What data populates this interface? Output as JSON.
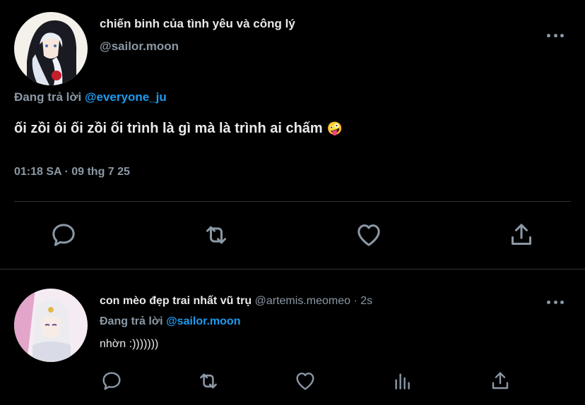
{
  "tweet": {
    "author_name": "chiến binh của tình yêu và công lý",
    "author_handle": "@sailor.moon",
    "reply_prefix": "Đang trả lời ",
    "reply_to": "@everyone_ju",
    "text": "ối zồi ôi ối zồi ối trình là gì mà là trình ai chấm",
    "emoji": "🤪",
    "time": "01:18 SA",
    "separator": "·",
    "date": "09 thg 7 25",
    "more_label": "•••"
  },
  "reply": {
    "author_name": "con mèo đẹp trai nhất vũ trụ",
    "author_handle": "@artemis.meomeo",
    "separator": "·",
    "age": "2s",
    "reply_prefix": "Đang trả lời ",
    "reply_to": "@sailor.moon",
    "text": "nhờn :)))))))"
  },
  "icons": {
    "reply": "speech-bubble-icon",
    "retweet": "retweet-icon",
    "like": "heart-icon",
    "share": "share-upload-icon",
    "analytics": "bar-chart-icon",
    "more": "more-dots-icon"
  },
  "colors": {
    "background": "#000000",
    "text_primary": "#e7e9ea",
    "text_secondary": "#8b98a5",
    "accent": "#1d9bf0",
    "divider": "#2f3336"
  }
}
